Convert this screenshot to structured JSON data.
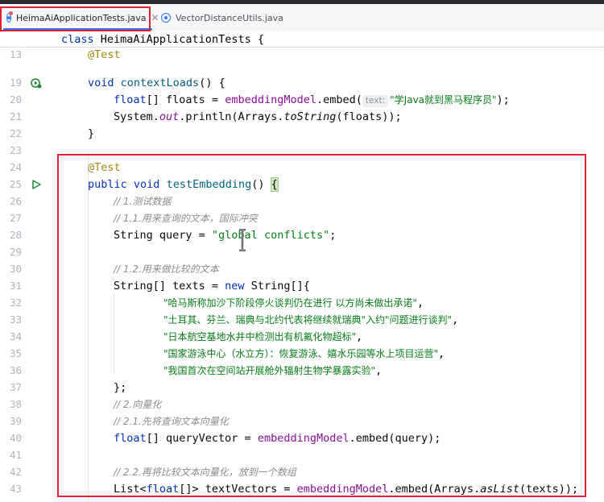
{
  "tabs": [
    {
      "label": "HeimaAiApplicationTests.java",
      "active": true,
      "close": "✕",
      "icon": "java-class-icon"
    },
    {
      "label": "VectorDistanceUtils.java",
      "active": false,
      "icon": "java-class-icon"
    }
  ],
  "sticky_header": {
    "keyword": "class",
    "name": " HeimaAiApplicationTests {"
  },
  "line_numbers": [
    "13",
    "19",
    "20",
    "21",
    "22",
    "23",
    "24",
    "25",
    "26",
    "27",
    "28",
    "29",
    "30",
    "31",
    "32",
    "33",
    "34",
    "35",
    "36",
    "37",
    "38",
    "39",
    "40",
    "41",
    "42",
    "43"
  ],
  "code": {
    "l13": {
      "ann": "@Test"
    },
    "l19": {
      "kw": "void",
      "fn": "contextLoads",
      "rest": "() {"
    },
    "l20": {
      "kw": "float",
      "a": "[] floats = ",
      "field": "embeddingModel",
      "b": ".embed(",
      "hint": "text:",
      "str": "\"学Java就到黑马程序员\"",
      "c": ");"
    },
    "l21": {
      "a": "System.",
      "field": "out",
      "b": ".println(Arrays.",
      "fn": "toString",
      "c": "(floats));"
    },
    "l22": {
      "a": "}"
    },
    "l24": {
      "ann": "@Test"
    },
    "l25": {
      "kw1": "public",
      "kw2": "void",
      "fn": "testEmbedding",
      "a": "() ",
      "brace": "{"
    },
    "l26": {
      "cmt": "// 1.测试数据"
    },
    "l27": {
      "cmt": "// 1.1.用来查询的文本，国际冲突"
    },
    "l28": {
      "a": "String query = ",
      "str": "\"global conflicts\"",
      "b": ";"
    },
    "l30": {
      "cmt": "// 1.2.用来做比较的文本"
    },
    "l31": {
      "a": "String[] texts = ",
      "kw": "new",
      "b": " String[]{"
    },
    "l32": {
      "str": "\"哈马斯称加沙下阶段停火谈判仍在进行 以方尚未做出承诺\"",
      "b": ","
    },
    "l33": {
      "str": "\"土耳其、芬兰、瑞典与北约代表将继续就瑞典\"入约\"问题进行谈判\"",
      "b": ","
    },
    "l34": {
      "str": "\"日本航空基地水井中检测出有机氟化物超标\"",
      "b": ","
    },
    "l35": {
      "str": "\"国家游泳中心（水立方）：恢复游泳、嬉水乐园等水上项目运营\"",
      "b": ","
    },
    "l36": {
      "str": "\"我国首次在空间站开展舱外辐射生物学暴露实验\"",
      "b": ","
    },
    "l37": {
      "a": "};"
    },
    "l38": {
      "cmt": "// 2.向量化"
    },
    "l39": {
      "cmt": "// 2.1.先将查询文本向量化"
    },
    "l40": {
      "kw": "float",
      "a": "[] queryVector = ",
      "field": "embeddingModel",
      "b": ".embed(query);"
    },
    "l42": {
      "cmt": "// 2.2.再将比较文本向量化，放到一个数组"
    },
    "l43": {
      "a": "List<",
      "kw": "float",
      "b": "[]> textVectors = ",
      "field": "embeddingModel",
      "c": ".embed(Arrays.",
      "fn": "asList",
      "d": "(texts));"
    }
  },
  "gutter": {
    "l19": "run-test-passed-icon",
    "l25": "run-test-icon"
  },
  "colors": {
    "highlight_box": "#e0202e",
    "tab_underline": "#3574f0"
  }
}
